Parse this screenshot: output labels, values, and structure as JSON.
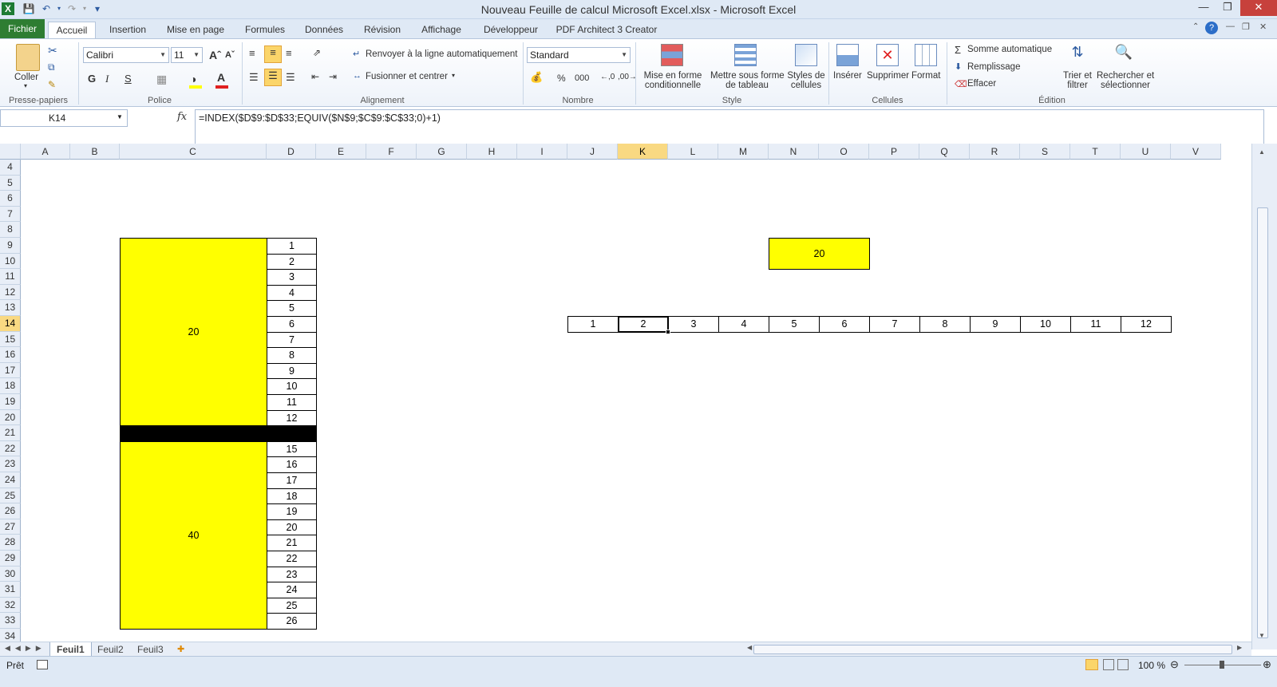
{
  "title": "Nouveau Feuille de calcul Microsoft Excel.xlsx - Microsoft Excel",
  "tabs": [
    "Fichier",
    "Accueil",
    "Insertion",
    "Mise en page",
    "Formules",
    "Données",
    "Révision",
    "Affichage",
    "Développeur",
    "PDF Architect 3 Creator"
  ],
  "ribbon": {
    "clipboard": {
      "paste": "Coller",
      "group": "Presse-papiers"
    },
    "font": {
      "name": "Calibri",
      "size": "11",
      "bold": "G",
      "italic": "I",
      "underline": "S",
      "group": "Police"
    },
    "alignment": {
      "wrap": "Renvoyer à la ligne automatiquement",
      "merge": "Fusionner et centrer",
      "group": "Alignement"
    },
    "number": {
      "format": "Standard",
      "percent": "%",
      "thousands": "000",
      "group": "Nombre"
    },
    "style": {
      "cond_line1": "Mise en forme",
      "cond_line2": "conditionnelle",
      "table_line1": "Mettre sous forme",
      "table_line2": "de tableau",
      "cell_line1": "Styles de",
      "cell_line2": "cellules",
      "group": "Style"
    },
    "cells": {
      "insert": "Insérer",
      "delete": "Supprimer",
      "format": "Format",
      "group": "Cellules"
    },
    "editing": {
      "autosum": "Somme automatique",
      "fill": "Remplissage",
      "clear": "Effacer",
      "sort_line1": "Trier et",
      "sort_line2": "filtrer",
      "find_line1": "Rechercher et",
      "find_line2": "sélectionner",
      "group": "Édition"
    }
  },
  "namebox": "K14",
  "formula": "=INDEX($D$9:$D$33;EQUIV($N$9;$C$9:$C$33;0)+1)",
  "columns": [
    "A",
    "B",
    "C",
    "D",
    "E",
    "F",
    "G",
    "H",
    "I",
    "J",
    "K",
    "L",
    "M",
    "N",
    "O",
    "P",
    "Q",
    "R",
    "S",
    "T",
    "U",
    "V"
  ],
  "rows": [
    "4",
    "5",
    "6",
    "7",
    "8",
    "9",
    "10",
    "11",
    "12",
    "13",
    "14",
    "15",
    "16",
    "17",
    "18",
    "19",
    "20",
    "21",
    "22",
    "23",
    "24",
    "25",
    "26",
    "27",
    "28",
    "29",
    "30",
    "31",
    "32",
    "33",
    "34"
  ],
  "cells": {
    "c_top": "20",
    "c_bottom": "40",
    "d_values": [
      "1",
      "2",
      "3",
      "4",
      "5",
      "6",
      "7",
      "8",
      "9",
      "10",
      "11",
      "12",
      "",
      "15",
      "16",
      "17",
      "18",
      "19",
      "20",
      "21",
      "22",
      "23",
      "24",
      "25",
      "26"
    ],
    "n9": "20",
    "row14": [
      "1",
      "2",
      "3",
      "4",
      "5",
      "6",
      "7",
      "8",
      "9",
      "10",
      "11",
      "12"
    ]
  },
  "sheets": [
    "Feuil1",
    "Feuil2",
    "Feuil3"
  ],
  "status": {
    "ready": "Prêt",
    "zoom": "100 %"
  },
  "colors": {
    "yellow": "#ffff00",
    "fichier_tab": "#2e7d32",
    "selection": "#f9d982"
  }
}
